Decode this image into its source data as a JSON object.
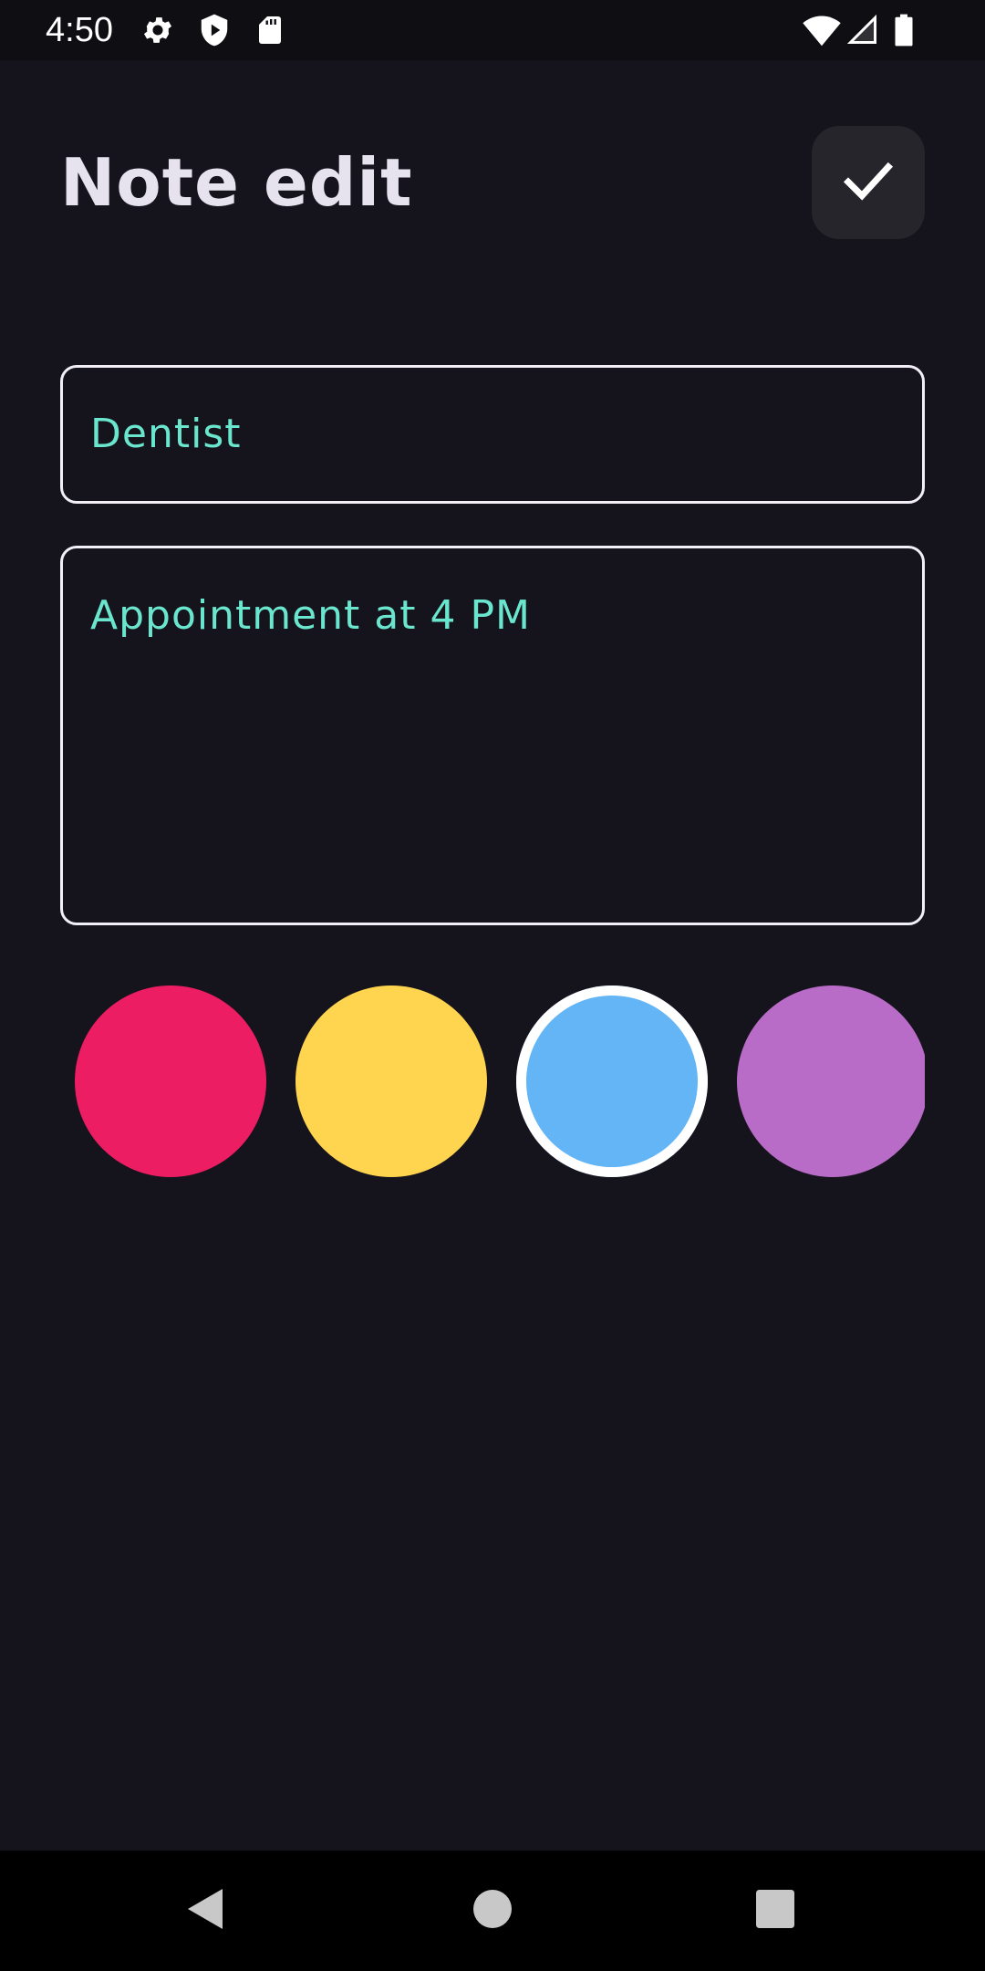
{
  "status_bar": {
    "time": "4:50",
    "icons": [
      "settings-icon",
      "shield-play-icon",
      "sd-card-icon",
      "wifi-icon",
      "signal-icon",
      "battery-icon"
    ]
  },
  "header": {
    "title": "Note edit",
    "save_icon": "check-icon"
  },
  "form": {
    "title_value": "Dentist",
    "content_value": "Appointment at 4 PM"
  },
  "color_picker": {
    "colors": [
      "#ec1d63",
      "#ffd54f",
      "#63b5f6",
      "#b96bc8"
    ],
    "selected_index": 2
  },
  "nav_bar": {
    "icons": [
      "back-icon",
      "home-icon",
      "recents-icon"
    ]
  },
  "theme": {
    "background": "#15131b",
    "accent_text": "#69e6cd",
    "border": "#f2f0f6"
  }
}
